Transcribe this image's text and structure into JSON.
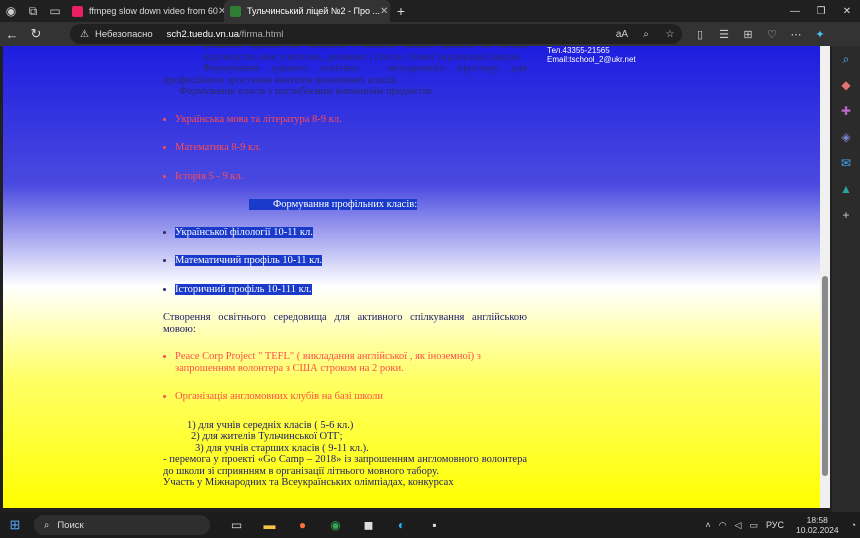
{
  "browser": {
    "tabs": [
      {
        "title": "ffmpeg slow down video from 60",
        "favicon_color": "#e91e63"
      },
      {
        "title": "Тульчинський ліцей №2 - Про ...",
        "favicon_color": "#2e7d32"
      }
    ],
    "security_label": "Небезопасно",
    "url_host": "sch2.tuedu.vn.ua",
    "url_path": "/firma.html"
  },
  "page": {
    "contact_line1": "Тел.43355-21565",
    "contact_email": "Email:tschool_2@ukr.net",
    "intro_line1": "розвиток здібностей, талантів і нахилів кожної дитини на основі партнерства між учителем, дитиною і сім'єю. Нової української школи.",
    "intro_line2": "Формування єдиного освітньо - методичного простору для професійного зростання вчителів початкових класів.",
    "intro_line3": "Формування класів з поглибленим вивченням предметів:",
    "subjects": [
      "Українська мова та література 8-9 кл.",
      " Математика 8-9 кл.",
      "Історія 5 - 9 кл."
    ],
    "profile_heading": "Формування профільних класів:",
    "profiles": [
      "Української філології 10-11 кл. ",
      "Математичний профіль 10-11 кл. ",
      " Історичний профіль 10-111 кл."
    ],
    "english_intro": "Створення освітнього середовища для активного спілкування англійською мовою:",
    "english_items": [
      "Peace Corp Project \" TEFL\" ( викладання англійської , як іноземної) з запрошенням волонтера з США строком на 2 роки.",
      "Організація англомовних клубів на базі школи"
    ],
    "clubs": [
      "1)  для учнів середніх класів ( 5-6 кл.)",
      "2) для жителів Тульчинської ОТГ;",
      "3)  для учнів  старших класів ( 9-11 кл.)."
    ],
    "camp": "- перемога у проекті «Go Camp – 2018» із запрошенням англомовного волонтера до школи зі сприянням в організації літнього мовного табору.",
    "olympiad": "Участь у Міжнародних та Всеукраїнських олімпіадах, конкурсах"
  },
  "taskbar": {
    "search_placeholder": "Поиск",
    "lang": "РУС",
    "time": "18:58",
    "date": "10.02.2024"
  }
}
